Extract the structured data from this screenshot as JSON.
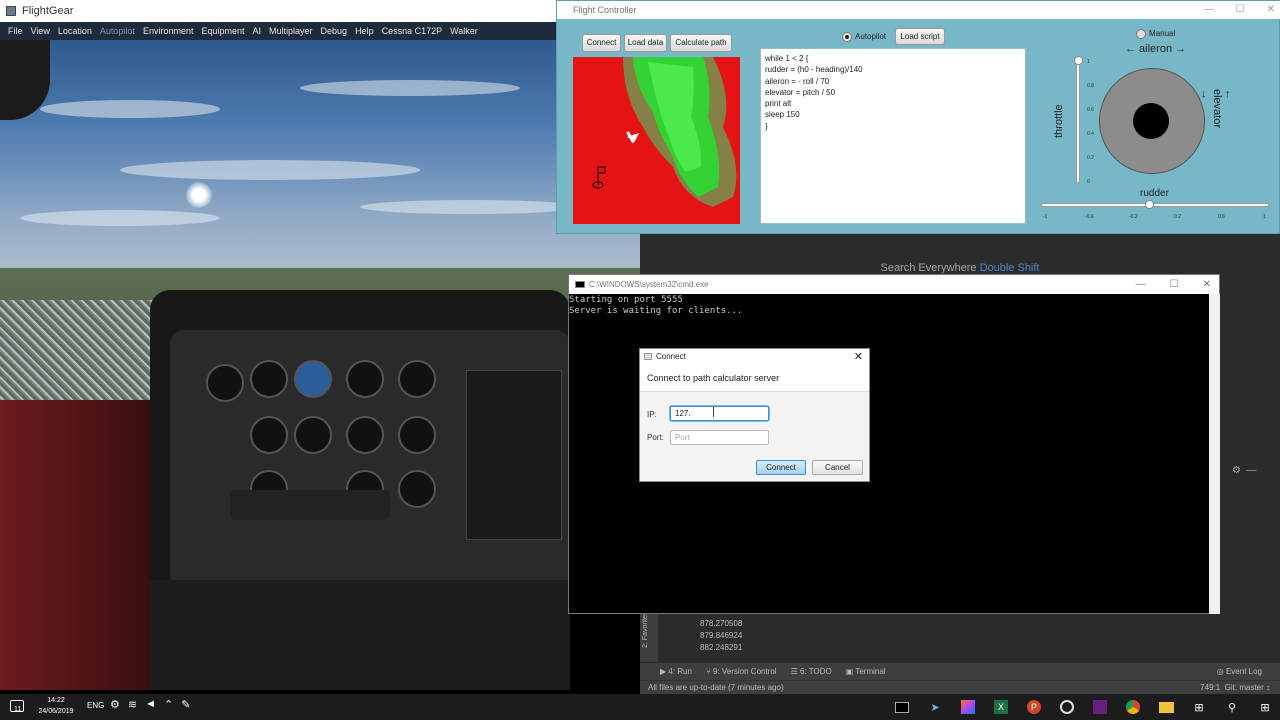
{
  "flightgear": {
    "title": "FlightGear",
    "menu": [
      "File",
      "View",
      "Location",
      "Autopilot",
      "Environment",
      "Equipment",
      "AI",
      "Multiplayer",
      "Debug",
      "Help",
      "Cessna C172P",
      "Walker"
    ],
    "disabled_menu_index": 3
  },
  "flight_controller": {
    "title": "Flight Controller",
    "buttons": {
      "connect": "Connect",
      "load_data": "Load data",
      "calculate_path": "Calculate path",
      "load_script": "Load script"
    },
    "mode": {
      "autopilot": "Autopilot",
      "manual": "Manual",
      "selected": "autopilot"
    },
    "script_lines": [
      "while 1 < 2 {",
      "rudder = (h0 - heading)/140",
      "aileron = - roll / 70",
      "elevator = pitch / 50",
      "print alt",
      "sleep 150",
      "}"
    ],
    "joystick": {
      "aileron_label": "← aileron →",
      "elevator_label": "← elevator →",
      "throttle_label": "throttle",
      "rudder_label": "rudder",
      "throttle_ticks": [
        "1",
        "0.8",
        "0.6",
        "0.4",
        "0.2",
        "0"
      ],
      "rudder_ticks": [
        "-1",
        "-0.6",
        "-0.2",
        "0.2",
        "0.6",
        "1"
      ],
      "throttle_value": 1.0,
      "rudder_value": -0.1
    }
  },
  "ide": {
    "search_hint": "Search Everywhere",
    "search_shortcut": "Double Shift",
    "output_lines": [
      "878.270508",
      "879.846924",
      "882.248291"
    ],
    "tabs": [
      "4: Run",
      "9: Version Control",
      "6: TODO",
      "Terminal"
    ],
    "event_log": "Event Log",
    "side_tab": "2: Favorites",
    "status": "All files are up-to-date (7 minutes ago)",
    "cursor_pos": "749:1",
    "git_branch": "Git: master ↕"
  },
  "cmd": {
    "title": "C:\\WINDOWS\\system32\\cmd.exe",
    "lines": [
      "Starting on port 5555",
      "Server is waiting for clients..."
    ]
  },
  "connect_dialog": {
    "title": "Connect",
    "heading": "Connect to path calculator server",
    "ip_label": "IP:",
    "ip_value": "127.",
    "port_label": "Port:",
    "port_placeholder": "Port",
    "connect_btn": "Connect",
    "cancel_btn": "Cancel"
  },
  "taskbar": {
    "time": "14:22",
    "date": "24/06/2019",
    "lang": "ENG",
    "badge": "11"
  }
}
